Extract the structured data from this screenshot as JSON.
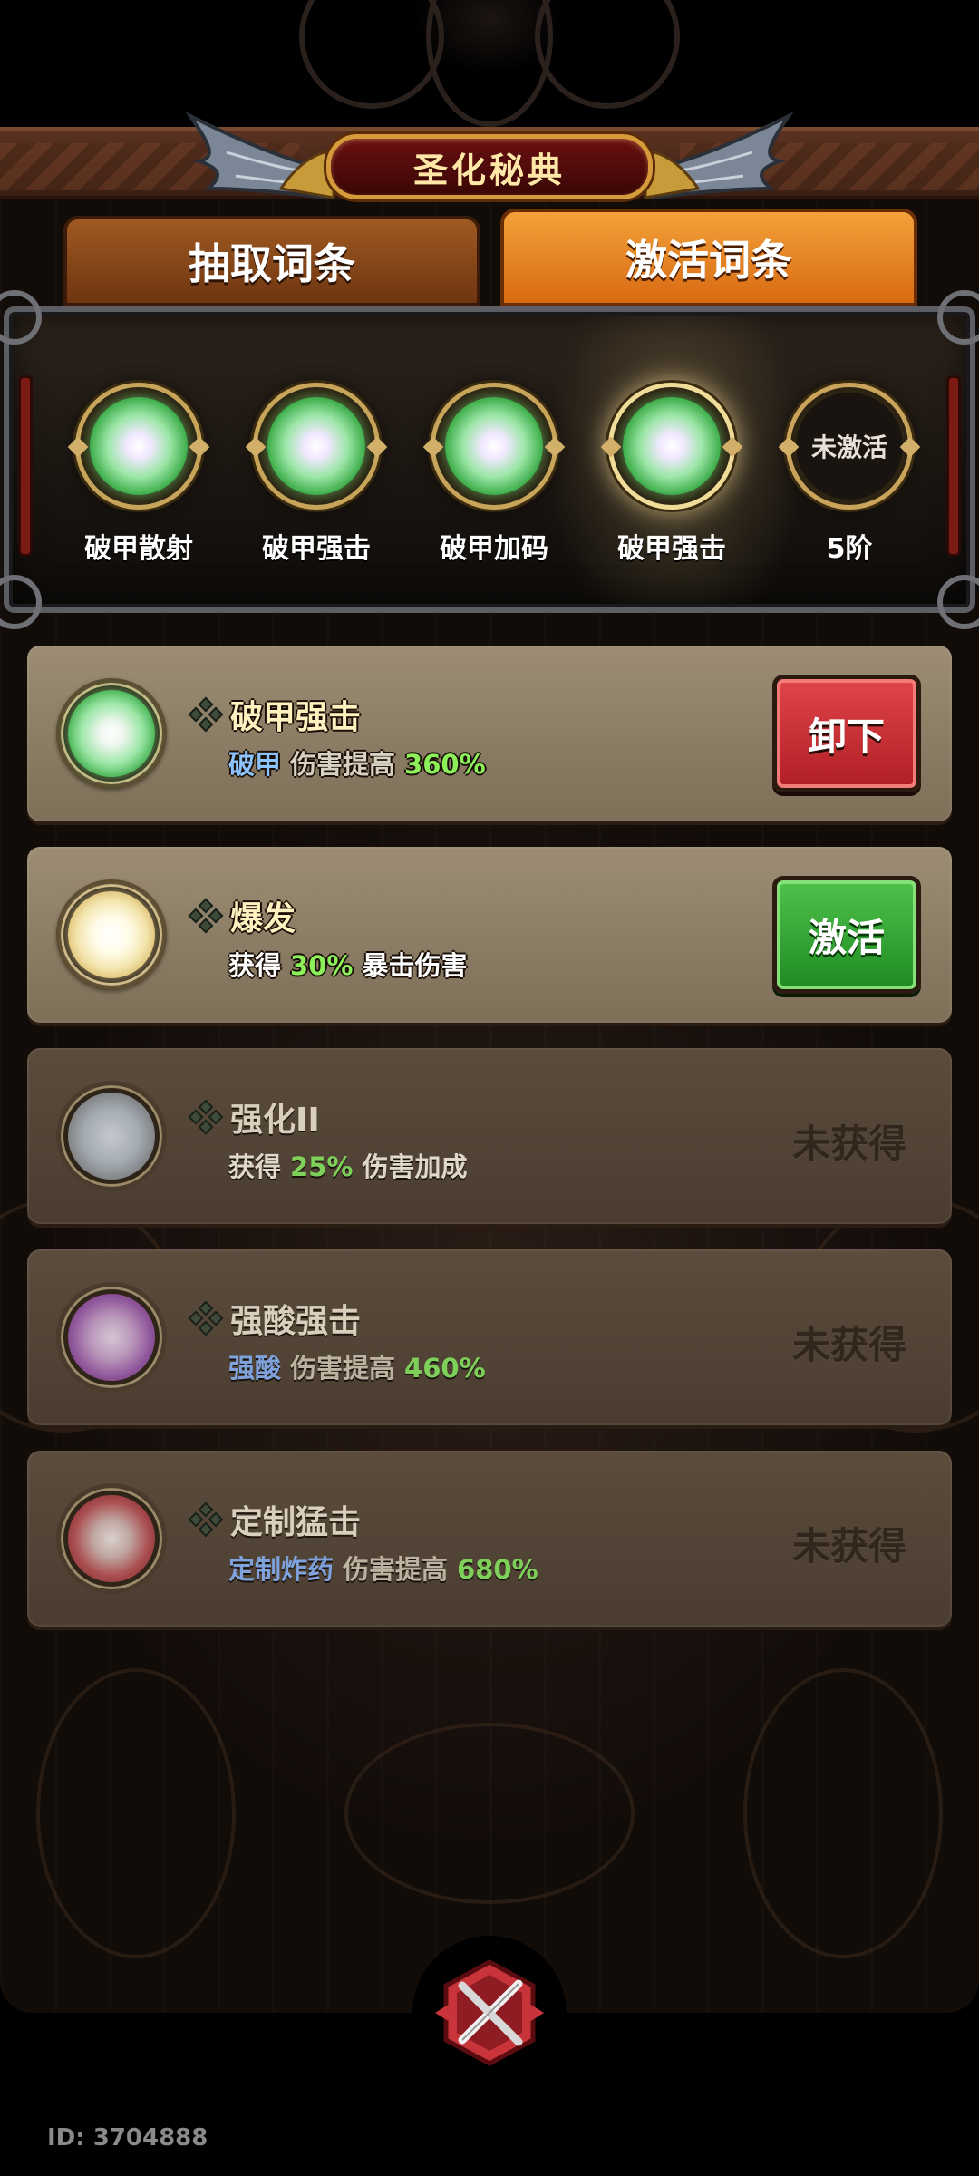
{
  "title": "圣化秘典",
  "tabs": {
    "extract": "抽取词条",
    "activate": "激活词条"
  },
  "slots": [
    {
      "label": "破甲散射",
      "state": "active",
      "color": "green"
    },
    {
      "label": "破甲强击",
      "state": "active",
      "color": "green"
    },
    {
      "label": "破甲加码",
      "state": "active",
      "color": "green"
    },
    {
      "label": "破甲强击",
      "state": "selected",
      "color": "green"
    },
    {
      "label": "5阶",
      "state": "empty",
      "orb_text": "未激活"
    }
  ],
  "entries": [
    {
      "name": "破甲强击",
      "desc": {
        "tag": "破甲",
        "text": "伤害提高",
        "value": "360%"
      },
      "button": "卸下",
      "orb_color": "green"
    },
    {
      "name": "爆发",
      "desc": {
        "pre": "获得",
        "value": "30%",
        "post": "暴击伤害"
      },
      "button": "激活",
      "orb_color": "yellow"
    },
    {
      "name": "强化II",
      "desc": {
        "pre": "获得",
        "value": "25%",
        "post": "伤害加成"
      },
      "status": "未获得",
      "orb_color": "white"
    },
    {
      "name": "强酸强击",
      "desc": {
        "tag": "强酸",
        "text": "伤害提高",
        "value": "460%"
      },
      "status": "未获得",
      "orb_color": "purple"
    },
    {
      "name": "定制猛击",
      "desc": {
        "tag": "定制炸药",
        "text": "伤害提高",
        "value": "680%"
      },
      "status": "未获得",
      "orb_color": "red"
    }
  ],
  "close_icon": "crossed-swords-close-icon",
  "player_id": "ID: 3704888",
  "colors": {
    "accent_orange": "#f3a13a",
    "btn_red": "#c8323a",
    "btn_green": "#2f9c30",
    "value_green": "#8cf05a",
    "tag_blue": "#8cc4ff"
  }
}
